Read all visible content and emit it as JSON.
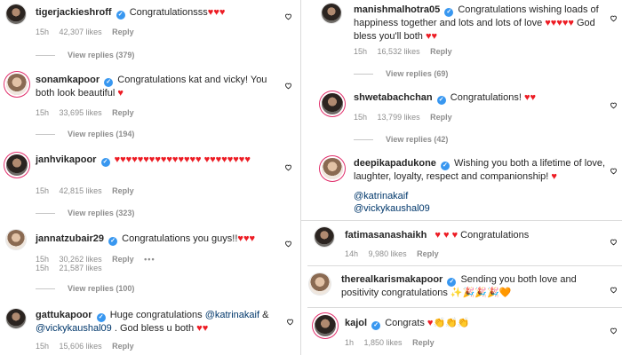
{
  "left": [
    {
      "username": "tigerjackieshroff",
      "verified": true,
      "text": "Congratulationsss",
      "hearts": "♥♥♥",
      "time": "15h",
      "likes": "42,307 likes",
      "reply": "Reply",
      "view_replies": "View replies (379)"
    },
    {
      "username": "sonamkapoor",
      "verified": true,
      "text": "Congratulations kat and vicky! You both look beautiful",
      "hearts": "♥",
      "time": "15h",
      "likes": "33,695 likes",
      "reply": "Reply",
      "view_replies": "View replies (194)"
    },
    {
      "username": "janhvikapoor",
      "verified": true,
      "text": "",
      "hearts": "♥♥♥♥♥♥♥♥♥♥♥♥♥♥♥ ♥♥♥♥♥♥♥♥",
      "time": "15h",
      "likes": "42,815 likes",
      "reply": "Reply",
      "view_replies": "View replies (323)"
    },
    {
      "username": "jannatzubair29",
      "verified": true,
      "text": "Congratulations you guys!!",
      "hearts": "♥♥♥",
      "time": "15h",
      "likes": "21,587 likes",
      "reply": "Reply",
      "likes_alt": "30,262 likes",
      "more": "•••",
      "view_replies": "View replies (100)"
    },
    {
      "username": "gattukapoor",
      "verified": true,
      "text": "Huge congratulations",
      "mention1": "@katrinakaif",
      "amp": "&",
      "mention2": "@vickykaushal09",
      "text2": ". God bless u both",
      "hearts": "♥♥",
      "time": "15h",
      "likes": "15,606 likes",
      "reply": "Reply"
    }
  ],
  "right_upper": [
    {
      "username": "manishmalhotra05",
      "verified": true,
      "text": "Congratulations wishing loads of happiness together and lots and lots of love",
      "hearts": "♥♥♥♥♥",
      "text2": "God bless you'll both",
      "hearts2": "♥♥",
      "time": "15h",
      "likes": "16,532 likes",
      "reply": "Reply",
      "view_replies": "View replies (69)"
    },
    {
      "username": "shwetabachchan",
      "verified": true,
      "text": "Congratulations!",
      "hearts": "♥♥",
      "time": "15h",
      "likes": "13,799 likes",
      "reply": "Reply",
      "view_replies": "View replies (42)"
    },
    {
      "username": "deepikapadukone",
      "verified": true,
      "text": "Wishing you both a lifetime of love, laughter, loyalty, respect and companionship!",
      "hearts": "♥",
      "mention1": "@katrinakaif",
      "mention2": "@vickykaushal09"
    }
  ],
  "right_lower": [
    {
      "username": "fatimasanashaikh",
      "verified": false,
      "text": "Congratulations",
      "hearts": "♥ ♥ ♥",
      "time": "14h",
      "likes": "9,980 likes",
      "reply": "Reply"
    },
    {
      "username": "therealkarismakapoor",
      "verified": true,
      "text": "Sending you both love and positivity",
      "text2": "congratulations",
      "emojis": "✨🎉🎉🎉🧡"
    },
    {
      "username": "kajol",
      "verified": true,
      "text": "Congrats",
      "emojis": "♥👏👏👏",
      "time": "1h",
      "likes": "1,850 likes",
      "reply": "Reply"
    }
  ],
  "icons": {
    "like": "heart-outline-icon",
    "verified": "verified-badge-icon",
    "more": "more-options-icon"
  },
  "colors": {
    "heart": "#ed1c24",
    "verified": "#3897f0",
    "mention": "#00376b",
    "meta": "#8e8e8e"
  }
}
